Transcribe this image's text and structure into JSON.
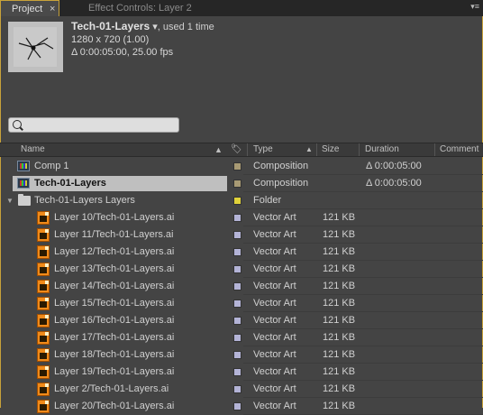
{
  "tabs": {
    "project": "Project",
    "effect_controls": "Effect Controls: Layer 2"
  },
  "preview": {
    "name": "Tech-01-Layers",
    "dropdown": "▾",
    "used": ", used 1 time",
    "resolution": "1280 x 720 (1.00)",
    "duration_fps": "Δ 0:00:05:00, 25.00 fps"
  },
  "search": {
    "placeholder": ""
  },
  "columns": {
    "name": "Name",
    "type": "Type",
    "size": "Size",
    "duration": "Duration",
    "comment": "Comment"
  },
  "colors": {
    "label_comp": "#a89a74",
    "label_folder": "#e0d23a",
    "label_vector": "#b3b3d6",
    "panel_highlight": "#c8a23a"
  },
  "items": [
    {
      "name": "Comp 1",
      "type": "Composition",
      "size": "",
      "duration": "Δ 0:00:05:00",
      "icon": "composition-icon",
      "selected": false
    },
    {
      "name": "Tech-01-Layers",
      "type": "Composition",
      "size": "",
      "duration": "Δ 0:00:05:00",
      "icon": "composition-icon",
      "selected": true
    },
    {
      "name": "Tech-01-Layers Layers",
      "type": "Folder",
      "size": "",
      "duration": "",
      "icon": "folder-icon",
      "selected": false
    },
    {
      "name": "Layer 10/Tech-01-Layers.ai",
      "type": "Vector Art",
      "size": "121 KB",
      "duration": "",
      "icon": "illustrator-file-icon",
      "selected": false
    },
    {
      "name": "Layer 11/Tech-01-Layers.ai",
      "type": "Vector Art",
      "size": "121 KB",
      "duration": "",
      "icon": "illustrator-file-icon",
      "selected": false
    },
    {
      "name": "Layer 12/Tech-01-Layers.ai",
      "type": "Vector Art",
      "size": "121 KB",
      "duration": "",
      "icon": "illustrator-file-icon",
      "selected": false
    },
    {
      "name": "Layer 13/Tech-01-Layers.ai",
      "type": "Vector Art",
      "size": "121 KB",
      "duration": "",
      "icon": "illustrator-file-icon",
      "selected": false
    },
    {
      "name": "Layer 14/Tech-01-Layers.ai",
      "type": "Vector Art",
      "size": "121 KB",
      "duration": "",
      "icon": "illustrator-file-icon",
      "selected": false
    },
    {
      "name": "Layer 15/Tech-01-Layers.ai",
      "type": "Vector Art",
      "size": "121 KB",
      "duration": "",
      "icon": "illustrator-file-icon",
      "selected": false
    },
    {
      "name": "Layer 16/Tech-01-Layers.ai",
      "type": "Vector Art",
      "size": "121 KB",
      "duration": "",
      "icon": "illustrator-file-icon",
      "selected": false
    },
    {
      "name": "Layer 17/Tech-01-Layers.ai",
      "type": "Vector Art",
      "size": "121 KB",
      "duration": "",
      "icon": "illustrator-file-icon",
      "selected": false
    },
    {
      "name": "Layer 18/Tech-01-Layers.ai",
      "type": "Vector Art",
      "size": "121 KB",
      "duration": "",
      "icon": "illustrator-file-icon",
      "selected": false
    },
    {
      "name": "Layer 19/Tech-01-Layers.ai",
      "type": "Vector Art",
      "size": "121 KB",
      "duration": "",
      "icon": "illustrator-file-icon",
      "selected": false
    },
    {
      "name": "Layer 2/Tech-01-Layers.ai",
      "type": "Vector Art",
      "size": "121 KB",
      "duration": "",
      "icon": "illustrator-file-icon",
      "selected": false
    },
    {
      "name": "Layer 20/Tech-01-Layers.ai",
      "type": "Vector Art",
      "size": "121 KB",
      "duration": "",
      "icon": "illustrator-file-icon",
      "selected": false
    }
  ]
}
